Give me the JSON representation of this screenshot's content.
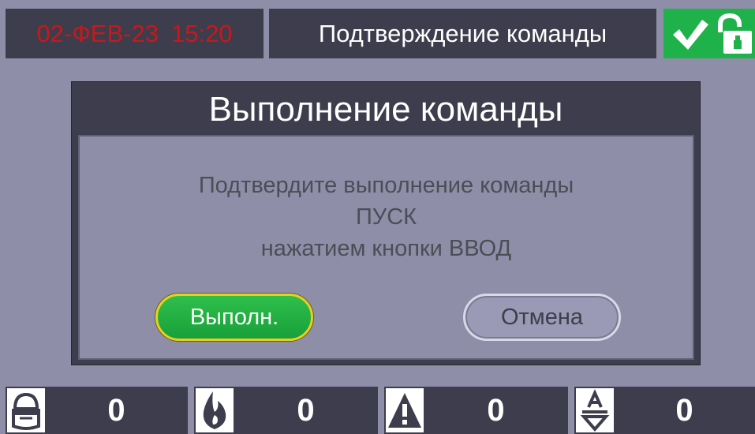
{
  "header": {
    "date": "02-ФЕВ-23",
    "time": "15:20",
    "title": "Подтверждение команды",
    "status_icons": [
      "check-icon",
      "unlocked-padlock-icon"
    ]
  },
  "dialog": {
    "title": "Выполнение команды",
    "message_line1": "Подтвердите выполнение команды",
    "message_line2": "ПУСК",
    "message_line3": "нажатием кнопки ВВОД",
    "confirm_label": "Выполн.",
    "cancel_label": "Отмена"
  },
  "footer": {
    "counters": [
      {
        "icon": "detector-icon",
        "value": "0"
      },
      {
        "icon": "fire-icon",
        "value": "0"
      },
      {
        "icon": "warning-icon",
        "value": "0"
      },
      {
        "icon": "fault-icon",
        "value": "0"
      }
    ]
  },
  "colors": {
    "background": "#8e8ea8",
    "panel": "#3d3d4d",
    "datetime": "#c8181a",
    "status_ok": "#1fb24a",
    "confirm_button": "#1fae44",
    "confirm_border": "#e8cf1f"
  }
}
